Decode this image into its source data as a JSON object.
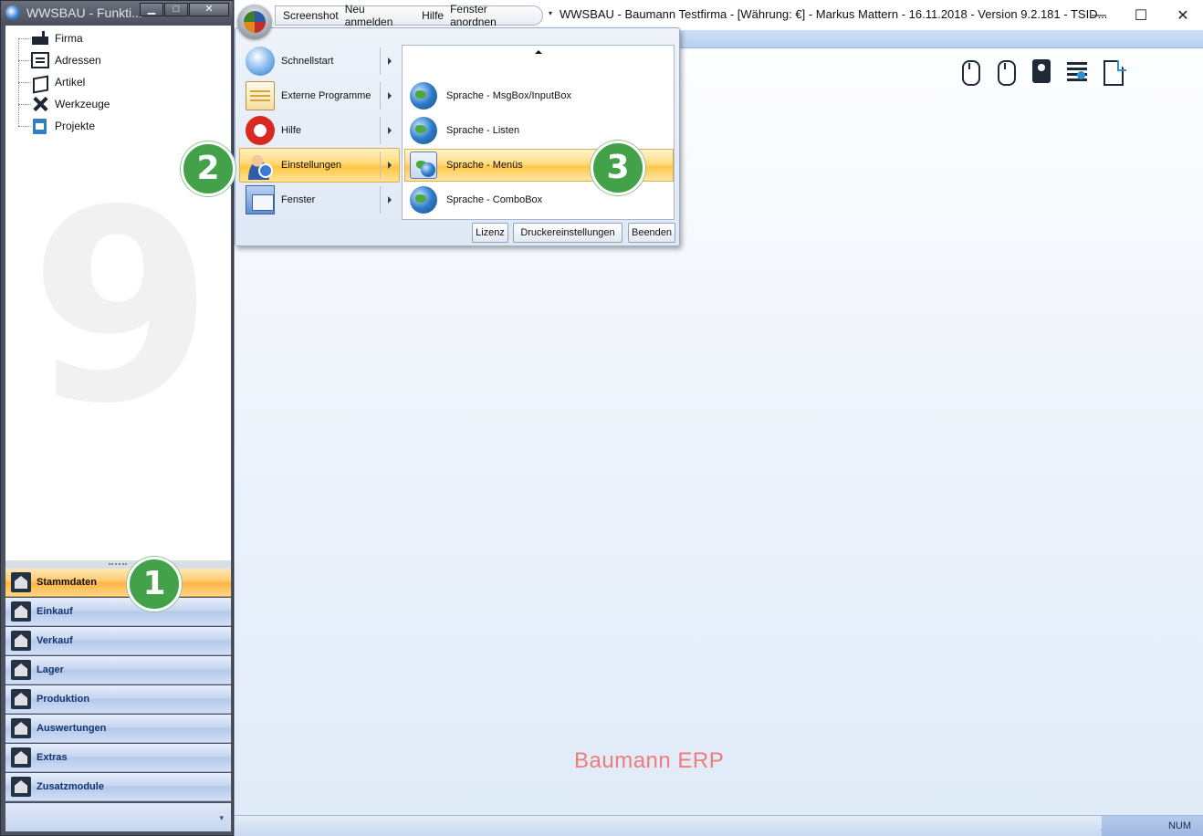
{
  "left_window": {
    "title": "WWSBAU - Funkti...",
    "buttons": {
      "minimize": "▁",
      "maximize": "□",
      "close": "✕"
    },
    "tree": [
      {
        "label": "Firma",
        "icon": "factory-icon"
      },
      {
        "label": "Adressen",
        "icon": "address-card-icon"
      },
      {
        "label": "Artikel",
        "icon": "box-icon"
      },
      {
        "label": "Werkzeuge",
        "icon": "tools-icon"
      },
      {
        "label": "Projekte",
        "icon": "project-icon"
      }
    ],
    "watermark": "9",
    "nav": [
      {
        "label": "Stammdaten",
        "active": true
      },
      {
        "label": "Einkauf"
      },
      {
        "label": "Verkauf"
      },
      {
        "label": "Lager"
      },
      {
        "label": "Produktion"
      },
      {
        "label": "Auswertungen"
      },
      {
        "label": "Extras"
      },
      {
        "label": "Zusatzmodule"
      }
    ],
    "nav_footer_chevron": "▾"
  },
  "main_window": {
    "quick_access": [
      "Screenshot",
      "Neu anmelden",
      "Hilfe",
      "Fenster anordnen"
    ],
    "quick_access_dropdown": "▾",
    "title": "WWSBAU - Baumann Testfirma - [Währung: €] -   Markus Mattern - 16.11.2018 - Version 9.2.181 - TSID...",
    "window_buttons": {
      "minimize": "—",
      "maximize": "☐",
      "close": "✕"
    },
    "toolbar_icons": [
      "mouse-left-icon",
      "mouse-right-icon",
      "tag-icon",
      "tree-structure-icon",
      "document-icon"
    ],
    "brand": "Baumann ERP",
    "status": {
      "num": "NUM",
      "grip": "⋰⋰"
    }
  },
  "app_menu": {
    "items": [
      {
        "label": "Schnellstart",
        "icon": "globe-start-icon"
      },
      {
        "label": "Externe Programme",
        "icon": "external-programs-icon"
      },
      {
        "label": "Hilfe",
        "icon": "lifebuoy-icon"
      },
      {
        "label": "Einstellungen",
        "icon": "user-settings-icon",
        "active": true
      },
      {
        "label": "Fenster",
        "icon": "windows-icon"
      }
    ],
    "arrow": "▸",
    "submenu": [
      {
        "label": "Sprache - MsgBox/InputBox"
      },
      {
        "label": "Sprache - Listen"
      },
      {
        "label": "Sprache - Menüs",
        "active": true
      },
      {
        "label": "Sprache - ComboBox"
      }
    ],
    "footer_buttons": [
      "Lizenz",
      "Druckereinstellungen",
      "Beenden"
    ]
  },
  "badges": [
    "1",
    "2",
    "3"
  ],
  "colors": {
    "accent_orange": "#ffc640",
    "badge_green": "#43a14a",
    "brand_text": "#ef7b7b",
    "nav_blue": "#c6d6f0"
  }
}
